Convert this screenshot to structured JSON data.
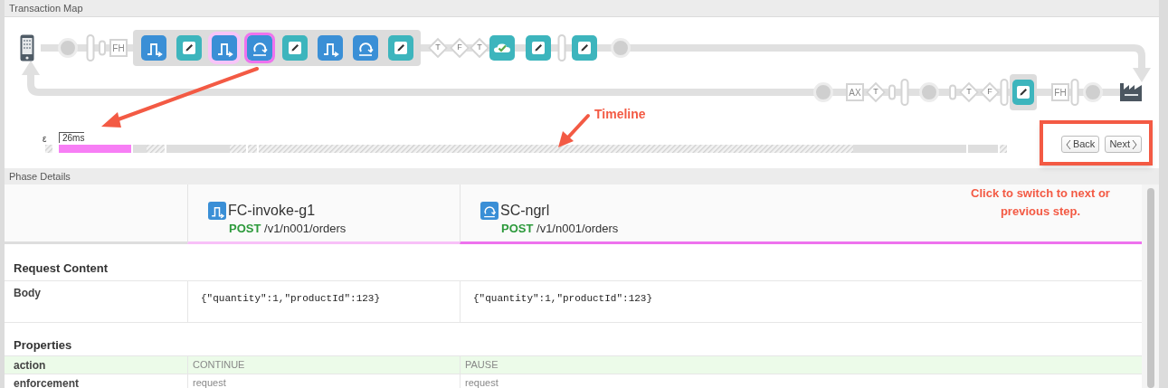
{
  "transaction_map": {
    "title": "Transaction Map",
    "top_nodes": [
      {
        "kind": "phone"
      },
      {
        "kind": "circle"
      },
      {
        "kind": "pill"
      },
      {
        "kind": "small-pill"
      },
      {
        "kind": "box",
        "label": "FH"
      },
      {
        "kind": "group",
        "children": [
          {
            "kind": "filter",
            "compared": false,
            "selected": false
          },
          {
            "kind": "edit",
            "compared": false,
            "selected": false
          },
          {
            "kind": "filter",
            "compared": true,
            "selected": false
          },
          {
            "kind": "loop",
            "compared": false,
            "selected": true
          },
          {
            "kind": "edit",
            "compared": false,
            "selected": false
          },
          {
            "kind": "filter",
            "compared": false,
            "selected": false
          },
          {
            "kind": "loop",
            "compared": false,
            "selected": false
          },
          {
            "kind": "edit",
            "compared": false,
            "selected": false
          }
        ]
      },
      {
        "kind": "diamond",
        "label": "T"
      },
      {
        "kind": "diamond",
        "label": "F"
      },
      {
        "kind": "diamond",
        "label": "T"
      },
      {
        "kind": "cloud",
        "compared": false,
        "selected": false
      },
      {
        "kind": "edit",
        "compared": false,
        "selected": false
      },
      {
        "kind": "pill"
      },
      {
        "kind": "edit",
        "compared": false,
        "selected": false
      },
      {
        "kind": "circle"
      }
    ],
    "bottom_nodes": [
      {
        "kind": "circle"
      },
      {
        "kind": "box",
        "label": "AX"
      },
      {
        "kind": "diamond",
        "label": "T"
      },
      {
        "kind": "small-pill"
      },
      {
        "kind": "pill"
      },
      {
        "kind": "circle"
      },
      {
        "kind": "small-pill"
      },
      {
        "kind": "diamond",
        "label": "T"
      },
      {
        "kind": "diamond",
        "label": "F"
      },
      {
        "kind": "pill"
      },
      {
        "kind": "group",
        "children": [
          {
            "kind": "edit",
            "compared": false,
            "selected": false
          }
        ]
      },
      {
        "kind": "box",
        "label": "FH"
      },
      {
        "kind": "pill"
      },
      {
        "kind": "circle"
      },
      {
        "kind": "factory"
      }
    ]
  },
  "timeline": {
    "start_label": "ε",
    "duration_label": "26ms"
  },
  "navigation": {
    "buttons": [
      {
        "kind": "back",
        "label": "Back"
      },
      {
        "kind": "next",
        "label": "Next"
      }
    ]
  },
  "annotations": {
    "timeline_label": "Timeline",
    "hint": "Click to switch to next or previous step."
  },
  "phase_details": {
    "title": "Phase Details",
    "columns": [
      {
        "kind": "filter",
        "name": "FC-invoke-g1",
        "method": "POST",
        "path": "/v1/n001/orders",
        "selected": false
      },
      {
        "kind": "loop",
        "name": "SC-ngrl",
        "method": "POST",
        "path": "/v1/n001/orders",
        "selected": true
      }
    ],
    "sections": [
      {
        "title": "Request Content",
        "rows": [
          {
            "label": "Body",
            "kind": "code",
            "highlighted": false,
            "values": [
              "{\"quantity\":1,\"productId\":123}",
              "{\"quantity\":1,\"productId\":123}"
            ]
          }
        ]
      },
      {
        "title": "Properties",
        "rows": [
          {
            "label": "action",
            "kind": "text",
            "highlighted": true,
            "values": [
              "CONTINUE",
              "PAUSE"
            ]
          },
          {
            "label": "enforcement",
            "kind": "text",
            "highlighted": false,
            "values": [
              "request",
              "request"
            ]
          }
        ]
      }
    ]
  }
}
